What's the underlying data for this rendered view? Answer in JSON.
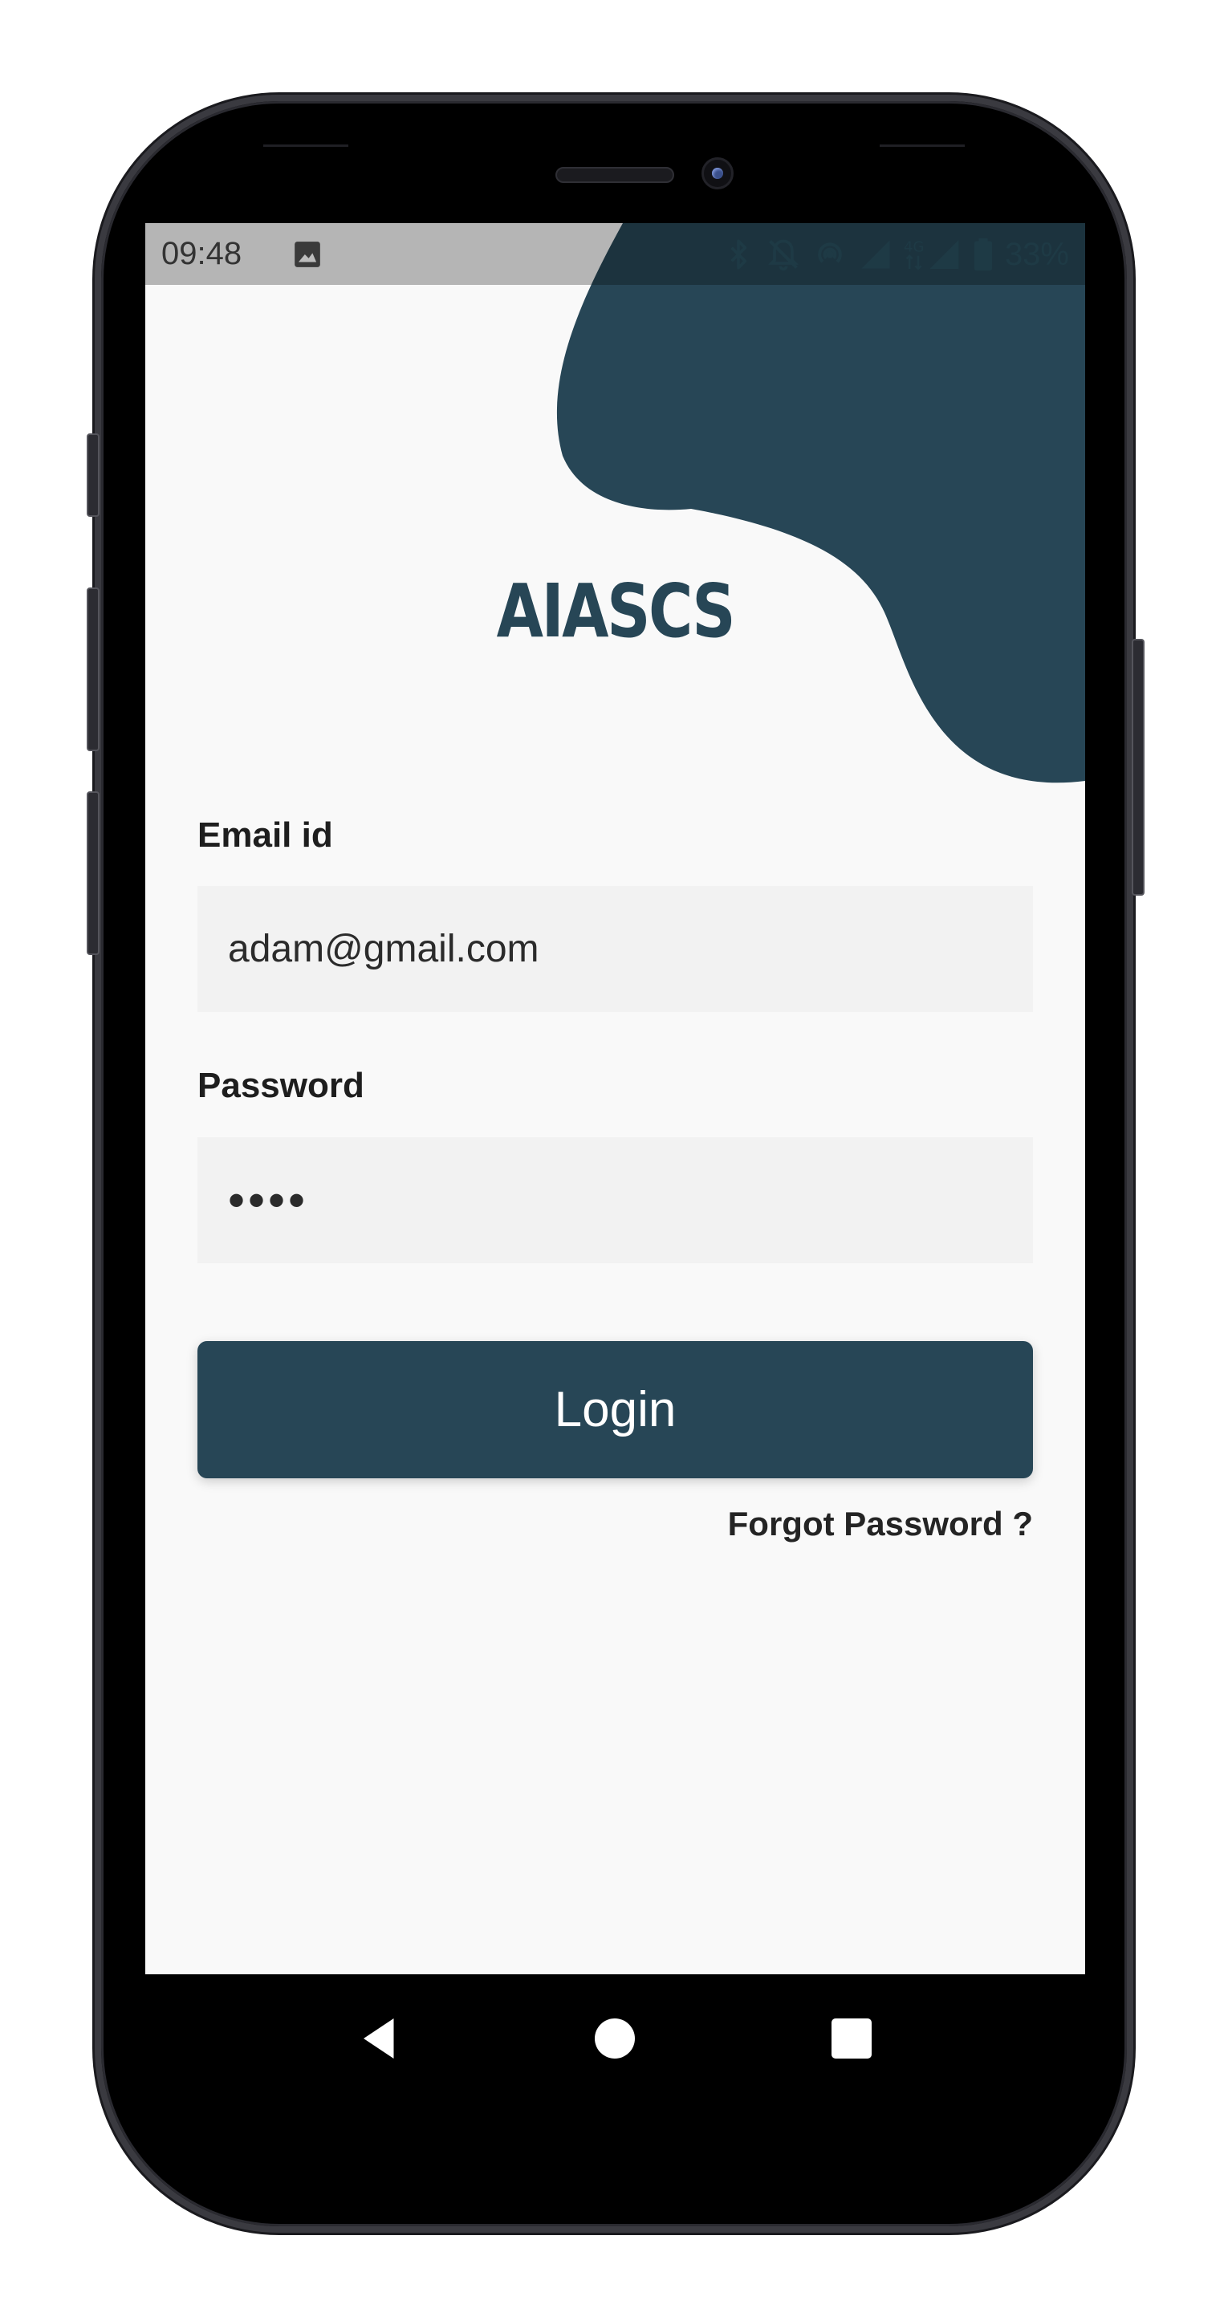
{
  "status_bar": {
    "time": "09:48",
    "battery": "33%",
    "icons": [
      "image-icon",
      "bluetooth-icon",
      "notifications-off-icon",
      "hotspot-icon",
      "signal-icon",
      "4g-signal-icon",
      "battery-icon"
    ]
  },
  "app": {
    "title": "AIASCS",
    "accent_color": "#274656"
  },
  "form": {
    "email_label": "Email id",
    "email_value": "adam@gmail.com",
    "password_label": "Password",
    "password_value": "••••",
    "login_label": "Login",
    "forgot_label": "Forgot Password ?"
  },
  "nav": {
    "buttons": [
      "back-icon",
      "home-icon",
      "recents-icon"
    ]
  }
}
